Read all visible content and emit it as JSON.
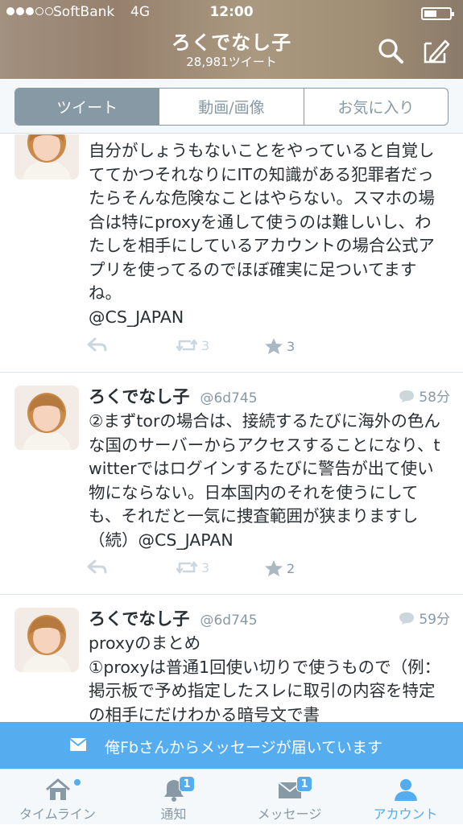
{
  "status_bar": {
    "carrier": "SoftBank",
    "network": "4G",
    "time": "12:00",
    "signal_bars_filled": 3,
    "signal_bars_total": 5
  },
  "header": {
    "profile_name": "ろくでなし子",
    "tweet_count": "28,981ツイート",
    "search_icon": "search-icon",
    "compose_icon": "compose-icon"
  },
  "tabs": {
    "items": [
      {
        "label": "ツイート",
        "active": true
      },
      {
        "label": "動画/画像",
        "active": false
      },
      {
        "label": "お気に入り",
        "active": false
      }
    ]
  },
  "tweets": [
    {
      "name": "",
      "handle": "",
      "time": "",
      "text": "自分がしょうもないことをやっていると自覚しててかつそれなりにITの知識がある犯罪者だったらそんな危険なことはやらない。スマホの場合は特にproxyを通して使うのは難しいし、わたしを相手にしているアカウントの場合公式アプリを使ってるのでほぼ確実に足ついてますね。\n@CS_JAPAN",
      "retweets": "3",
      "favorites": "3"
    },
    {
      "name": "ろくでなし子",
      "handle": "@6d745",
      "time": "58分",
      "text": "②まずtorの場合は、接続するたびに海外の色んな国のサーバーからアクセスすることになり、twitterではログインするたびに警告が出て使い物にならない。日本国内のそれを使うにしても、それだと一気に捜査範囲が狭まりますし（続）@CS_JAPAN",
      "retweets": "3",
      "favorites": "2"
    },
    {
      "name": "ろくでなし子",
      "handle": "@6d745",
      "time": "59分",
      "text": "proxyのまとめ\n①proxyは普通1回使い切りで使うもので（例：掲示板で予め指定したスレに取引の内容を特定の相手にだけわかる暗号文で書",
      "retweets": "",
      "favorites": ""
    }
  ],
  "banner": {
    "text": "俺Fbさんからメッセージが届いています",
    "icon": "envelope-icon"
  },
  "tabbar": {
    "items": [
      {
        "label": "タイムライン",
        "icon": "home-icon",
        "badge": ""
      },
      {
        "label": "通知",
        "icon": "bell-icon",
        "badge": "1"
      },
      {
        "label": "メッセージ",
        "icon": "message-icon",
        "badge": "1"
      },
      {
        "label": "アカウント",
        "icon": "person-icon",
        "badge": ""
      }
    ],
    "active_index": 3
  },
  "colors": {
    "accent": "#55acee",
    "muted": "#8899a6",
    "text": "#292f33",
    "divider": "#e1e8ed"
  }
}
